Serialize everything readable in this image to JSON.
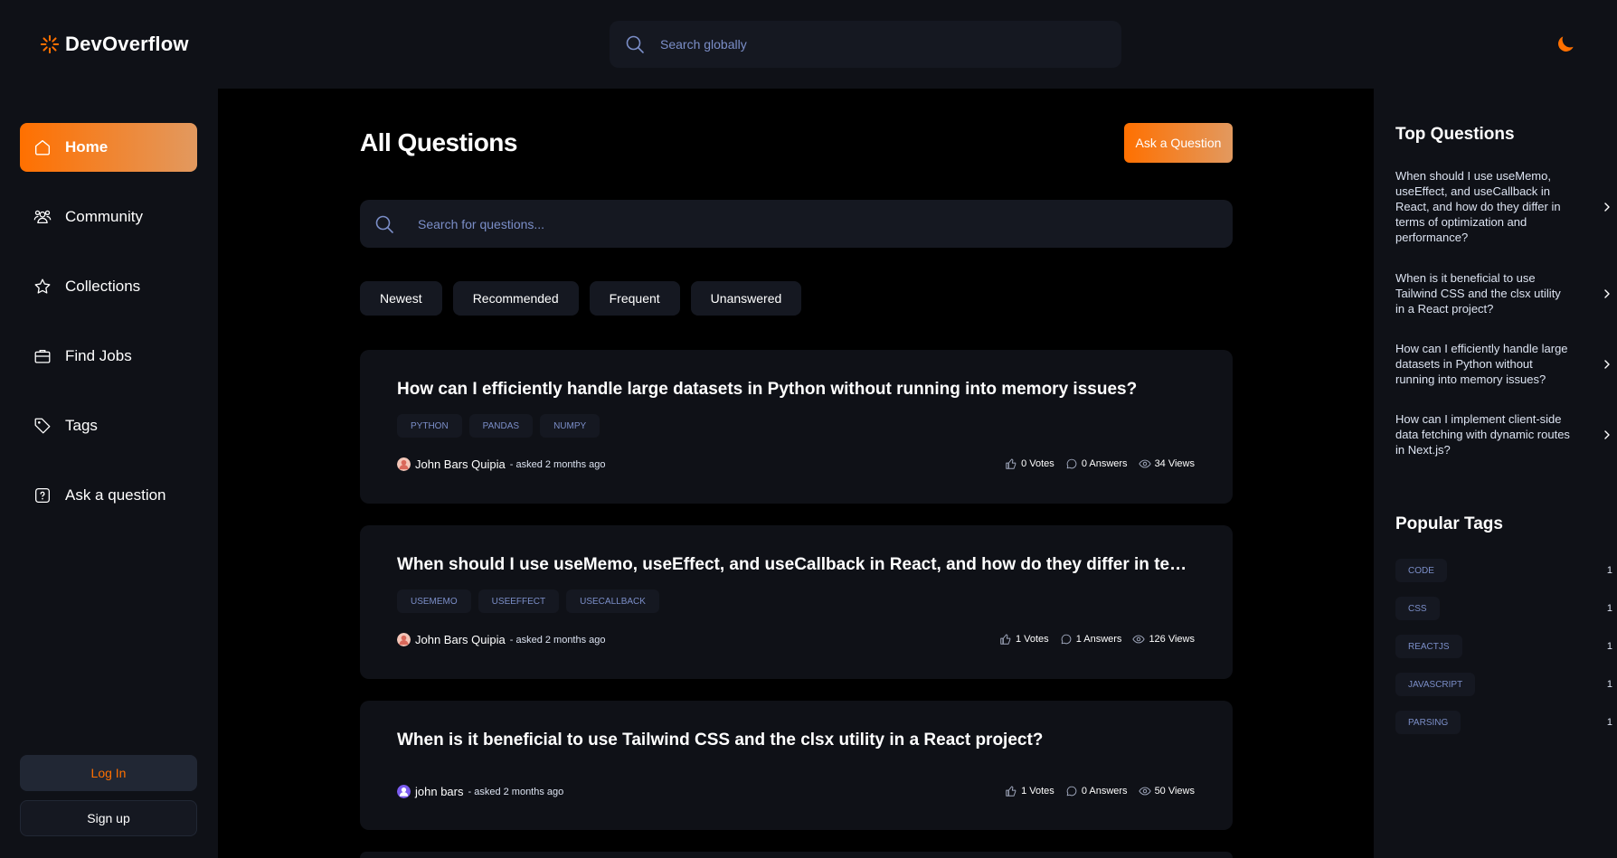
{
  "app": {
    "name": "DevOverflow"
  },
  "header": {
    "search_placeholder": "Search globally"
  },
  "sidebar": {
    "items": [
      {
        "label": "Home",
        "icon": "home-icon",
        "active": true
      },
      {
        "label": "Community",
        "icon": "users-icon"
      },
      {
        "label": "Collections",
        "icon": "star-icon"
      },
      {
        "label": "Find Jobs",
        "icon": "suitcase-icon"
      },
      {
        "label": "Tags",
        "icon": "tag-icon"
      },
      {
        "label": "Ask a question",
        "icon": "question-icon"
      }
    ],
    "login_label": "Log In",
    "signup_label": "Sign up"
  },
  "main": {
    "title": "All Questions",
    "ask_button": "Ask a Question",
    "search_placeholder": "Search for questions...",
    "filters": [
      "Newest",
      "Recommended",
      "Frequent",
      "Unanswered"
    ],
    "questions": [
      {
        "title": "How can I efficiently handle large datasets in Python without running into memory issues?",
        "tags": [
          "PYTHON",
          "PANDAS",
          "NUMPY"
        ],
        "author": "John Bars Quipia",
        "asked": "- asked 2 months ago",
        "votes": "0 Votes",
        "answers": "0 Answers",
        "views": "34 Views"
      },
      {
        "title": "When should I use useMemo, useEffect, and useCallback in React, and how do they differ in terms of optimization and performance?",
        "tags": [
          "USEMEMO",
          "USEEFFECT",
          "USECALLBACK"
        ],
        "author": "John Bars Quipia",
        "asked": "- asked 2 months ago",
        "votes": "1 Votes",
        "answers": "1 Answers",
        "views": "126 Views"
      },
      {
        "title": "When is it beneficial to use Tailwind CSS and the clsx utility in a React project?",
        "tags": [],
        "author": "john bars",
        "asked": "- asked 2 months ago",
        "votes": "1 Votes",
        "answers": "0 Answers",
        "views": "50 Views"
      }
    ]
  },
  "rightbar": {
    "top_questions_title": "Top Questions",
    "top_questions": [
      "When should I use useMemo, useEffect, and useCallback in React, and how do they differ in terms of optimization and performance?",
      "When is it beneficial to use Tailwind CSS and the clsx utility in a React project?",
      "How can I efficiently handle large datasets in Python without running into memory issues?",
      "How can I implement client-side data fetching with dynamic routes in Next.js?"
    ],
    "popular_tags_title": "Popular Tags",
    "popular_tags": [
      {
        "name": "CODE",
        "count": "1"
      },
      {
        "name": "CSS",
        "count": "1"
      },
      {
        "name": "REACTJS",
        "count": "1"
      },
      {
        "name": "JAVASCRIPT",
        "count": "1"
      },
      {
        "name": "PARSING",
        "count": "1"
      }
    ]
  },
  "colors": {
    "accent": "#ff7000",
    "accent_light": "#e2995f",
    "panel": "#0f1117",
    "card": "#151821",
    "tag_text": "#7b8ec8"
  }
}
